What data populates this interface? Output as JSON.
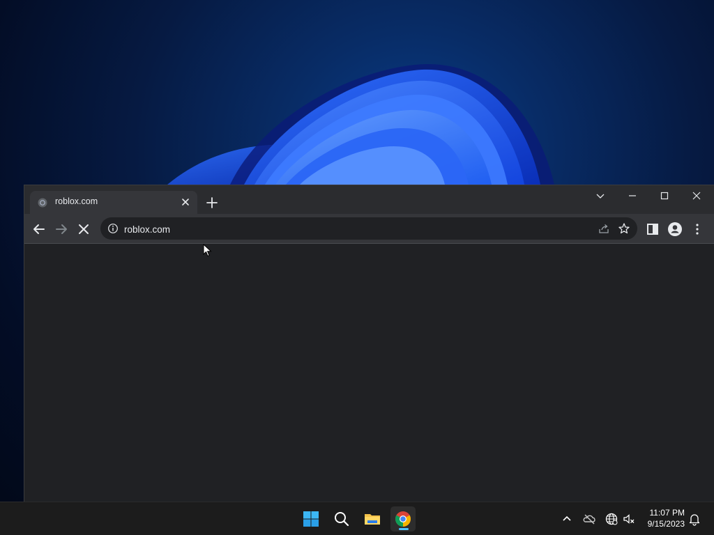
{
  "browser": {
    "tab": {
      "title": "roblox.com",
      "favicon": "globe-icon"
    },
    "address": {
      "url": "roblox.com"
    },
    "window_controls": [
      "tab-search-chevron-icon",
      "minimize-icon",
      "maximize-icon",
      "close-icon"
    ],
    "toolbar_icons": [
      "back-arrow-icon",
      "forward-arrow-icon",
      "stop-loading-icon",
      "info-icon",
      "share-icon",
      "star-icon",
      "side-panel-icon",
      "profile-icon",
      "kebab-menu-icon"
    ]
  },
  "taskbar": {
    "apps": [
      "windows-start-icon",
      "search-icon",
      "file-explorer-icon",
      "chrome-icon"
    ],
    "tray": [
      "chevron-up-icon",
      "onedrive-icon",
      "network-globe-icon",
      "speaker-muted-icon"
    ],
    "clock": {
      "time": "11:07 PM",
      "date": "9/15/2023"
    },
    "accent": "#4cc2ff"
  }
}
